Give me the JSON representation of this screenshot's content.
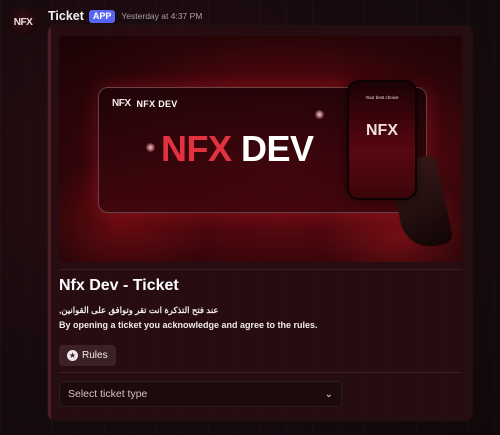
{
  "message": {
    "avatar_logo": "NFX",
    "username": "Ticket",
    "badge": "APP",
    "timestamp": "Yesterday at 4:37 PM"
  },
  "banner": {
    "brand_logo": "NFX",
    "brand_text": "NFX DEV",
    "title_part1": "NFX",
    "title_part2": "DEV",
    "phone_caption": "Your best choice",
    "phone_logo": "NFX"
  },
  "embed": {
    "title": "Nfx Dev - Ticket",
    "description_ar": "عند فتح التذكرة انت تقر وتوافق على القوانين,",
    "description_en": "By opening a ticket you acknowledge and agree to the rules."
  },
  "components": {
    "rules_button": {
      "label": "Rules",
      "icon": "star-icon"
    },
    "select": {
      "placeholder": "Select ticket type",
      "icon": "chevron-down-icon"
    }
  },
  "colors": {
    "accent_badge": "#5865f2",
    "brand_red": "#e23240",
    "background": "#140a0c"
  }
}
